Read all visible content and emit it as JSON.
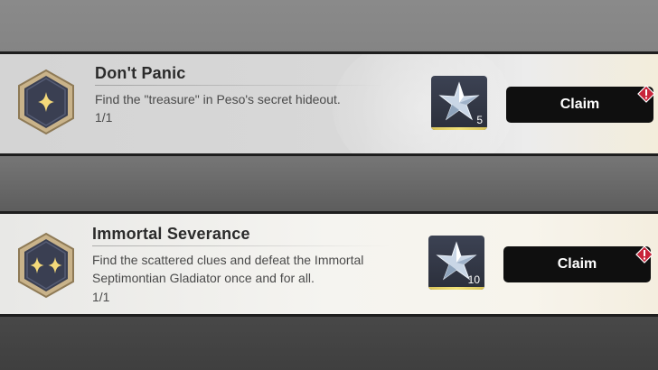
{
  "achievements": [
    {
      "title": "Don't Panic",
      "description": "Find the \"treasure\" in Peso's secret hideout.",
      "progress": "1/1",
      "badge_icon": "single-sparkle-icon",
      "reward": {
        "icon": "star-crystal-icon",
        "quantity": "5"
      },
      "claim_label": "Claim",
      "alert_icon": "exclamation-diamond-icon"
    },
    {
      "title": "Immortal Severance",
      "description": "Find the scattered clues and defeat the Immortal Septimontian Gladiator once and for all.",
      "progress": "1/1",
      "badge_icon": "double-sparkle-icon",
      "reward": {
        "icon": "star-crystal-icon",
        "quantity": "10"
      },
      "claim_label": "Claim",
      "alert_icon": "exclamation-diamond-icon"
    }
  ],
  "colors": {
    "badge_fill": "#3a3f52",
    "badge_rim": "#b8a072",
    "sparkle": "#f4d97a",
    "claim_bg": "#0f0f0f",
    "alert": "#c8243a",
    "reward_bar": "#f2e27a"
  }
}
